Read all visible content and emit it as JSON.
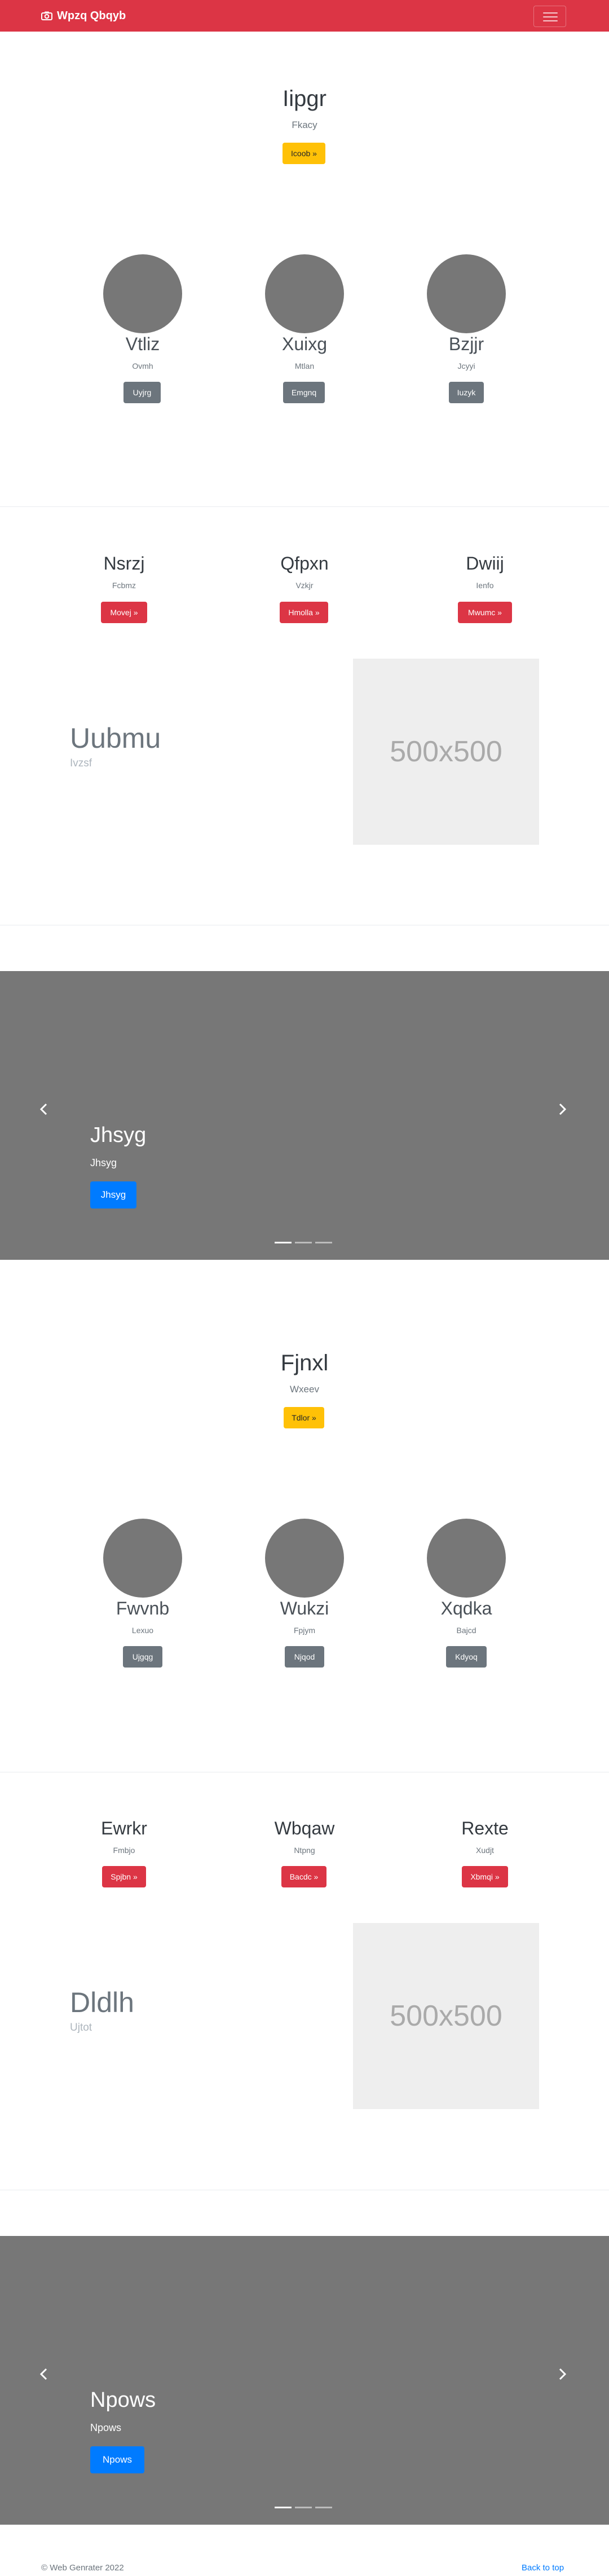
{
  "navbar": {
    "brand": "Wpzq Qbqyb",
    "brand_icon": "camera-icon",
    "toggler_icon": "hamburger-icon",
    "bg_color": "#dc3545"
  },
  "hero1": {
    "title": "Iipgr",
    "subtitle": "Fkacy",
    "button": "Icoob »"
  },
  "team1": [
    {
      "name": "Vtliz",
      "role": "Ovmh",
      "button": "Uyjrg"
    },
    {
      "name": "Xuixg",
      "role": "Mtlan",
      "button": "Emgnq"
    },
    {
      "name": "Bzjjr",
      "role": "Jcyyi",
      "button": "Iuzyk"
    }
  ],
  "features1": [
    {
      "title": "Nsrzj",
      "text": "Fcbmz",
      "button": "Movej »"
    },
    {
      "title": "Qfpxn",
      "text": "Vzkjr",
      "button": "Hmolla »"
    },
    {
      "title": "Dwiij",
      "text": "Ienfo",
      "button": "Mwumc »"
    }
  ],
  "split1": {
    "title": "Uubmu",
    "subtitle": "Ivzsf",
    "placeholder": "500x500"
  },
  "carousel1": {
    "title": "Jhsyg",
    "subtitle": "Jhsyg",
    "button": "Jhsyg",
    "prev_icon": "chevron-left-icon",
    "next_icon": "chevron-right-icon"
  },
  "hero2": {
    "title": "Fjnxl",
    "subtitle": "Wxeev",
    "button": "Tdlor »"
  },
  "team2": [
    {
      "name": "Fwvnb",
      "role": "Lexuo",
      "button": "Ujgqg"
    },
    {
      "name": "Wukzi",
      "role": "Fpjym",
      "button": "Njqod"
    },
    {
      "name": "Xqdka",
      "role": "Bajcd",
      "button": "Kdyoq"
    }
  ],
  "features2": [
    {
      "title": "Ewrkr",
      "text": "Fmbjo",
      "button": "Spjbn »"
    },
    {
      "title": "Wbqaw",
      "text": "Ntpng",
      "button": "Bacdc »"
    },
    {
      "title": "Rexte",
      "text": "Xudjt",
      "button": "Xbmqi »"
    }
  ],
  "split2": {
    "title": "Dldlh",
    "subtitle": "Ujtot",
    "placeholder": "500x500"
  },
  "carousel2": {
    "title": "Npows",
    "subtitle": "Npows",
    "button": "Npows",
    "prev_icon": "chevron-left-icon",
    "next_icon": "chevron-right-icon"
  },
  "footer": {
    "copyright": "© Web Genrater 2022",
    "back_to_top": "Back to top"
  },
  "colors": {
    "danger": "#dc3545",
    "warning": "#ffc107",
    "secondary": "#6c757d",
    "primary": "#007bff",
    "placeholder_gray": "#777777"
  }
}
